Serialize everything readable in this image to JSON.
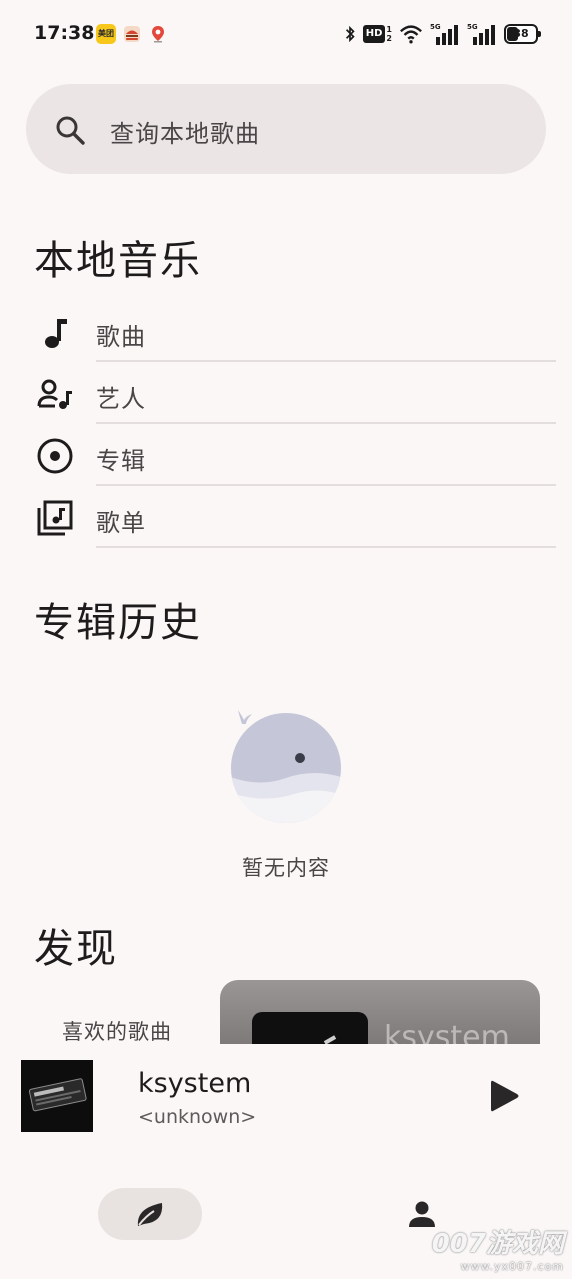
{
  "status_bar": {
    "time": "17:38",
    "notification_icons": [
      "meituan-icon",
      "burger-icon",
      "map-pin-icon"
    ],
    "meituan_text": "美团",
    "hd": "HD",
    "signal1_label": "5G",
    "signal2_label": "5G",
    "battery": "38"
  },
  "search": {
    "placeholder": "查询本地歌曲"
  },
  "local_music": {
    "title": "本地音乐",
    "items": [
      {
        "label": "歌曲",
        "icon": "music-note-icon"
      },
      {
        "label": "艺人",
        "icon": "artist-icon"
      },
      {
        "label": "专辑",
        "icon": "album-icon"
      },
      {
        "label": "歌单",
        "icon": "playlist-icon"
      }
    ]
  },
  "album_history": {
    "title": "专辑历史",
    "empty_text": "暂无内容"
  },
  "discover": {
    "title": "发现",
    "favorite_label": "喜欢的歌曲",
    "card_title": "ksystem"
  },
  "now_playing": {
    "title": "ksystem",
    "artist": "<unknown>"
  },
  "bottom_nav": {
    "items": [
      {
        "icon": "leaf-icon",
        "selected": true
      },
      {
        "icon": "person-icon",
        "selected": false
      }
    ]
  },
  "watermark": {
    "main": "007游戏网",
    "sub": "www.yx007.com"
  },
  "colors": {
    "background": "#fbf7f6",
    "search_bg": "#ebe6e5",
    "text_primary": "#1d1b1c",
    "text_secondary": "#4a4647"
  }
}
